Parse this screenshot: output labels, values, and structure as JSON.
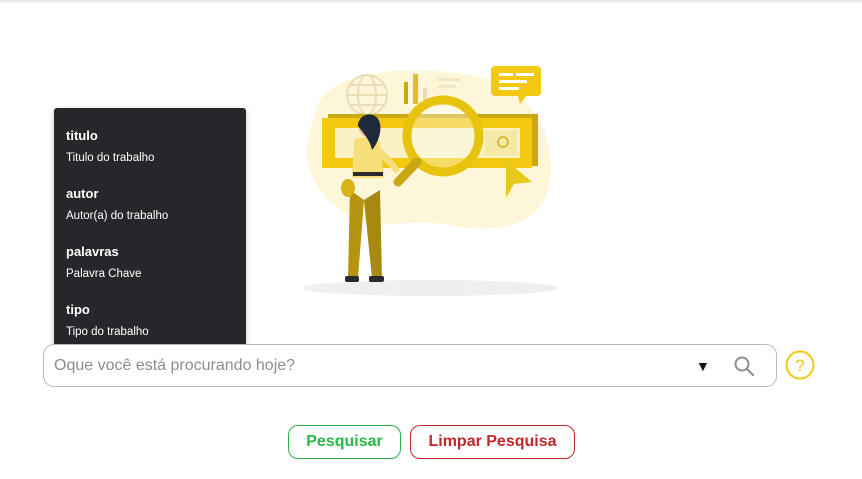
{
  "search": {
    "placeholder": "Oque você está procurando hoje?",
    "value": "",
    "dropdown_icon": "caret-down-icon",
    "search_icon": "magnifier-icon"
  },
  "help": {
    "icon": "question-circle-icon",
    "color": "#f2c811"
  },
  "tooltip": {
    "items": [
      {
        "key": "titulo",
        "desc": "Titulo do trabalho"
      },
      {
        "key": "autor",
        "desc": "Autor(a) do trabalho"
      },
      {
        "key": "palavras",
        "desc": "Palavra Chave"
      },
      {
        "key": "tipo",
        "desc": "Tipo do trabalho"
      }
    ]
  },
  "buttons": {
    "search_label": "Pesquisar",
    "clear_label": "Limpar Pesquisa"
  },
  "colors": {
    "accent_yellow": "#f2c811",
    "search_green": "#2db54a",
    "clear_red": "#c0282d",
    "tooltip_bg": "#26272b"
  }
}
